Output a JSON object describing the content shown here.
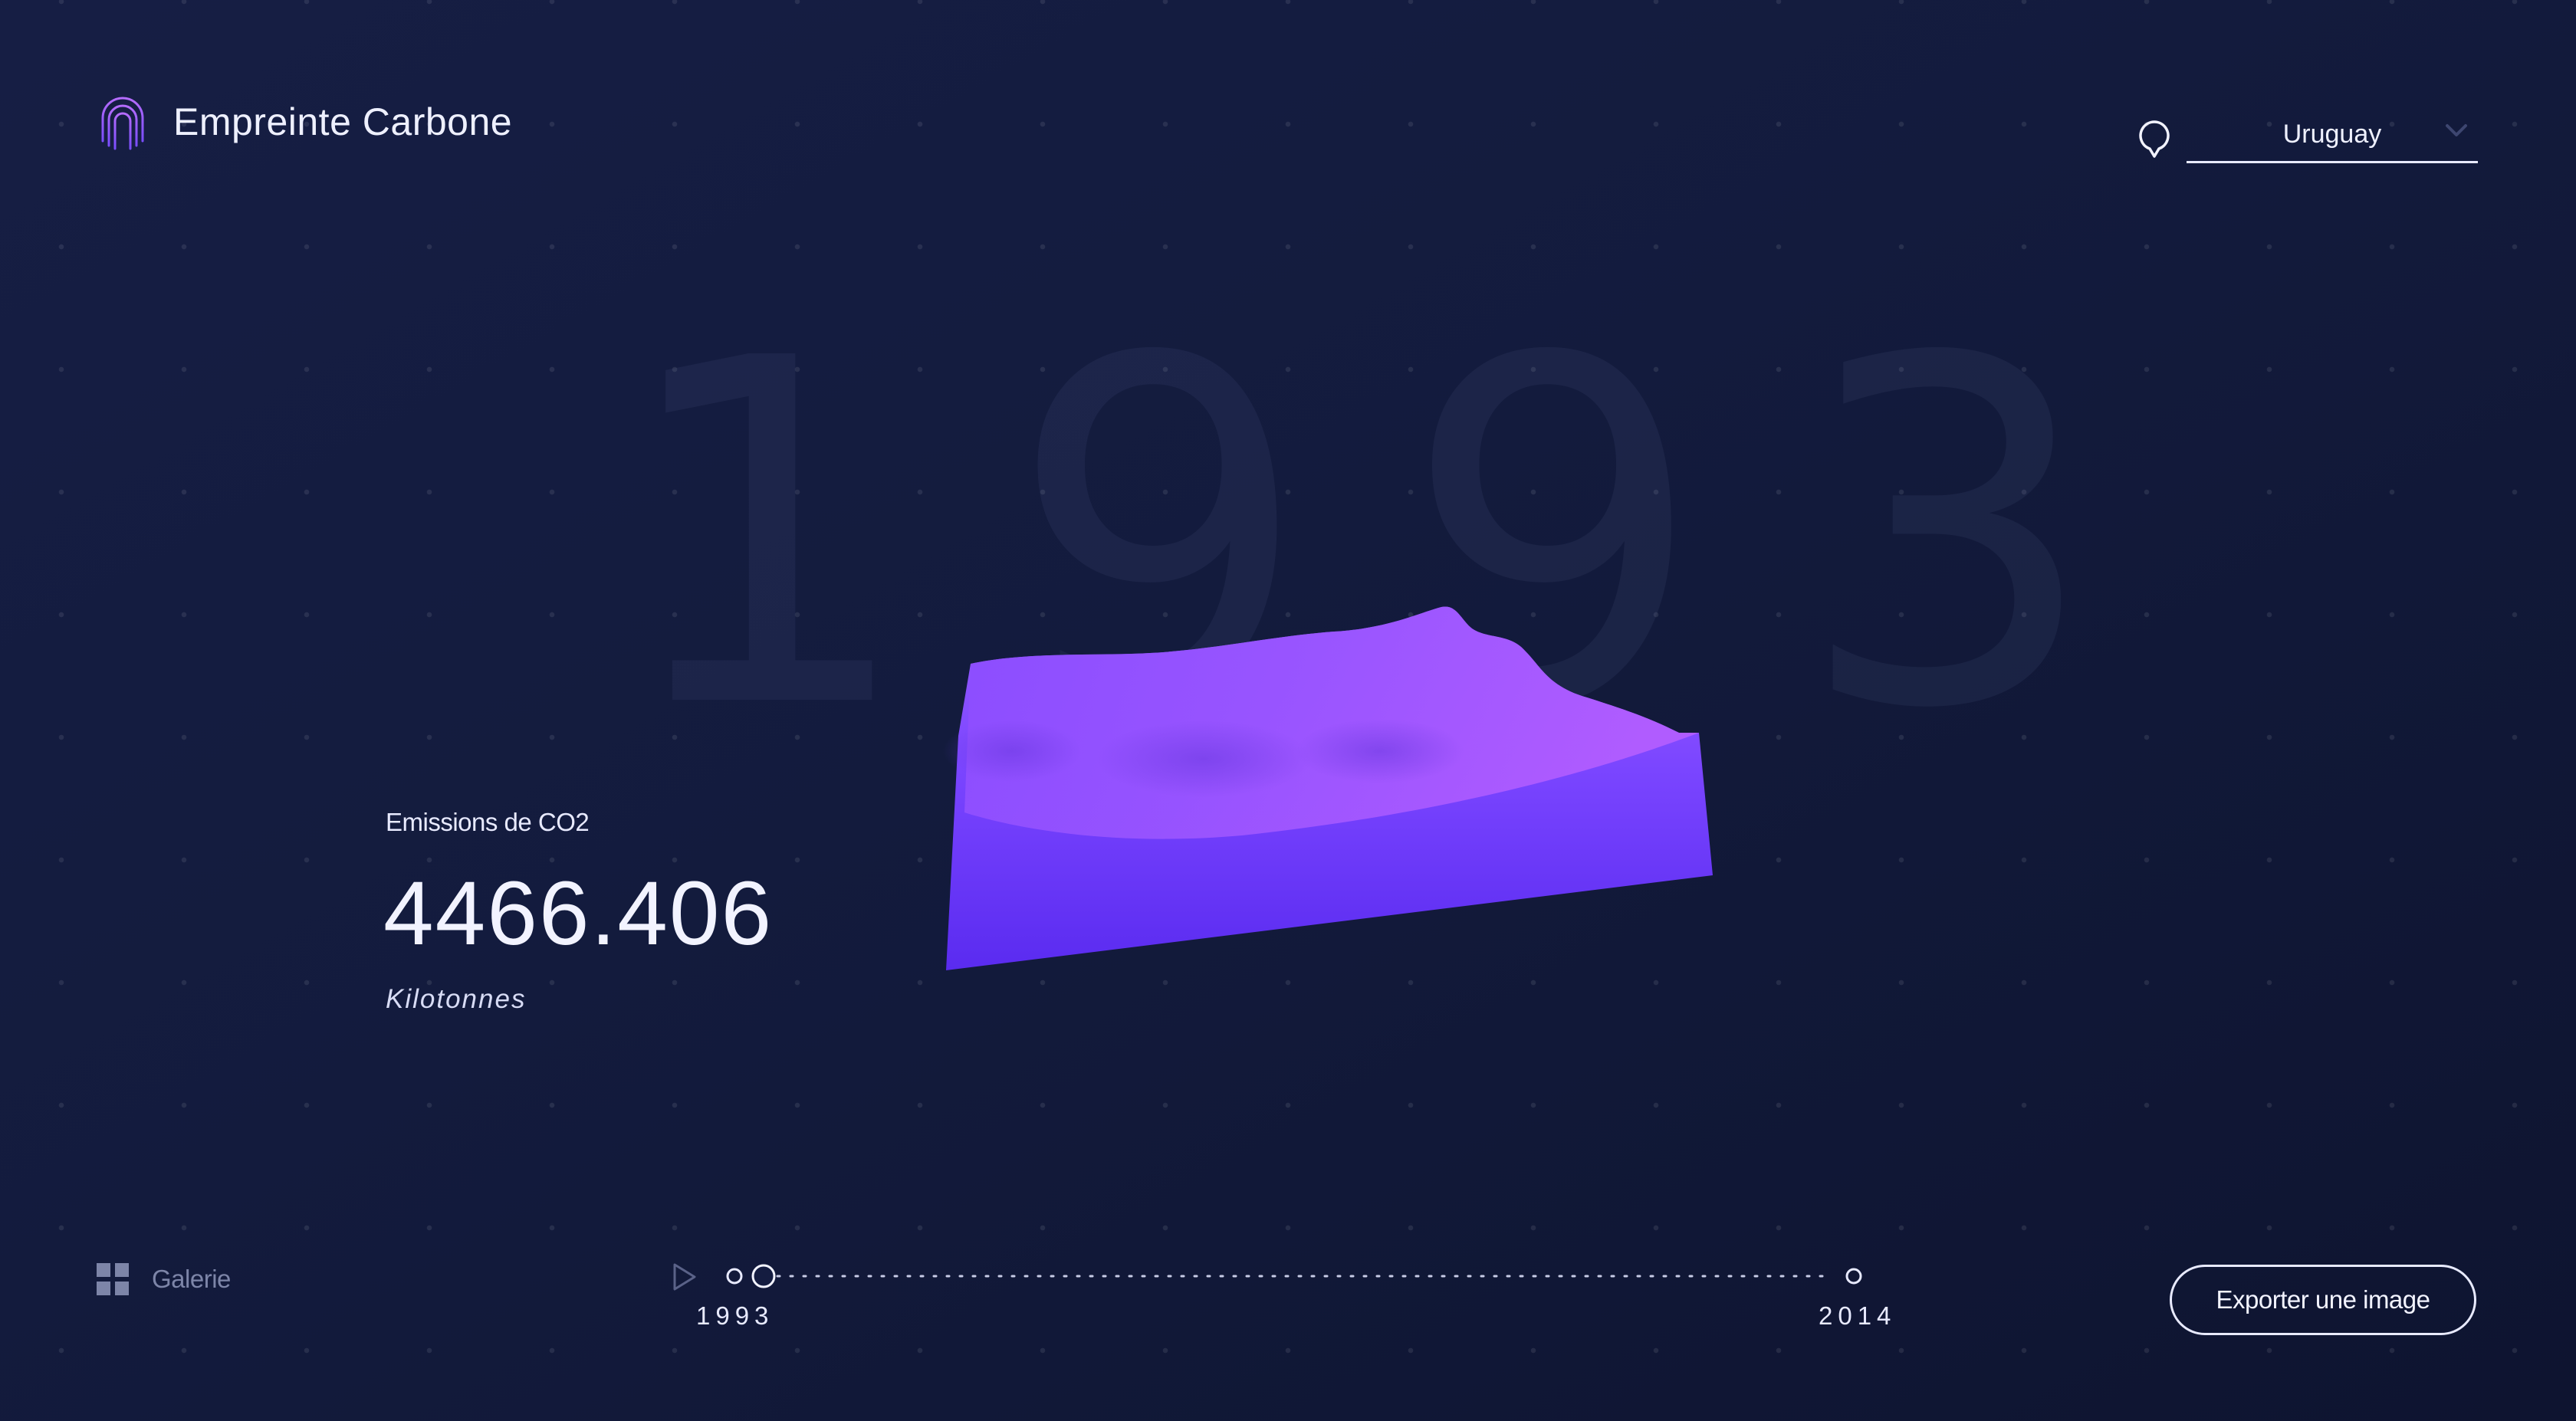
{
  "header": {
    "app_title": "Empreinte Carbone",
    "logo_icon": "fingerprint-icon",
    "location_icon": "map-pin-icon",
    "country_select": {
      "selected": "Uruguay",
      "icon": "chevron-down-icon"
    }
  },
  "main": {
    "year": "1993",
    "metric_label": "Emissions de CO2",
    "metric_value": "4466.406",
    "metric_unit": "Kilotonnes"
  },
  "footer": {
    "gallery_label": "Galerie",
    "gallery_icon": "grid-icon",
    "play_icon": "play-icon",
    "timeline": {
      "start_year": "1993",
      "end_year": "2014",
      "progress": 0
    },
    "export_label": "Exporter une image"
  },
  "colors": {
    "background": "#141c40",
    "accent_purple": "#8b4dff",
    "accent_pink": "#b25cff",
    "text_primary": "#eef0ff",
    "text_muted": "#7d85a8"
  }
}
